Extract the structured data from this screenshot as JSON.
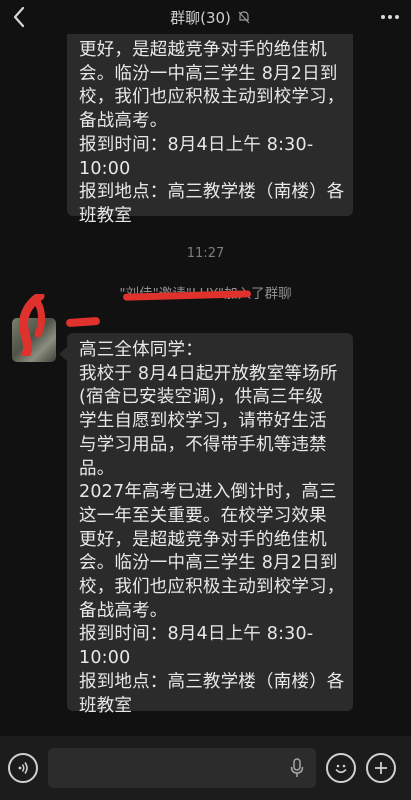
{
  "header": {
    "title": "群聊(30)",
    "back_icon": "chevron-left-icon",
    "mute_icon": "bell-off-icon",
    "more_icon": "ellipsis-icon"
  },
  "messages": {
    "top_bubble_lines": [
      "更好，是超越竞争对手的绝佳机",
      "会。临汾一中高三学生 8月2日到",
      "校，我们也应积极主动到校学习，",
      "备战高考。",
      "报到时间：8月4日上午 8:30-",
      "10:00",
      "报到地点：高三教学楼（南楼）各",
      "班教室"
    ],
    "time": "11:27",
    "system_notice": "\"刘佳\"邀请\"LHY\"加入了群聊",
    "main_bubble_lines": [
      "高三全体同学：",
      "我校于 8月4日起开放教室等场所",
      "(宿舍已安装空调)，供高三年级",
      "学生自愿到校学习，请带好生活",
      "与学习用品，不得带手机等违禁",
      "品。",
      "2027年高考已进入倒计时，高三",
      "这一年至关重要。在校学习效果",
      "更好，是超越竞争对手的绝佳机",
      "会。临汾一中高三学生 8月2日到",
      "校，我们也应积极主动到校学习，",
      "备战高考。",
      "报到时间：8月4日上午 8:30-",
      "10:00",
      "报到地点：高三教学楼（南楼）各",
      "班教室"
    ]
  },
  "input_bar": {
    "voice_icon": "voice-icon",
    "mic_icon": "microphone-icon",
    "emoji_icon": "emoji-icon",
    "plus_icon": "plus-icon"
  },
  "colors": {
    "background": "#111111",
    "bubble": "#2b2b2b",
    "redaction": "#e0322d",
    "input_bar": "#1c1c1c"
  }
}
